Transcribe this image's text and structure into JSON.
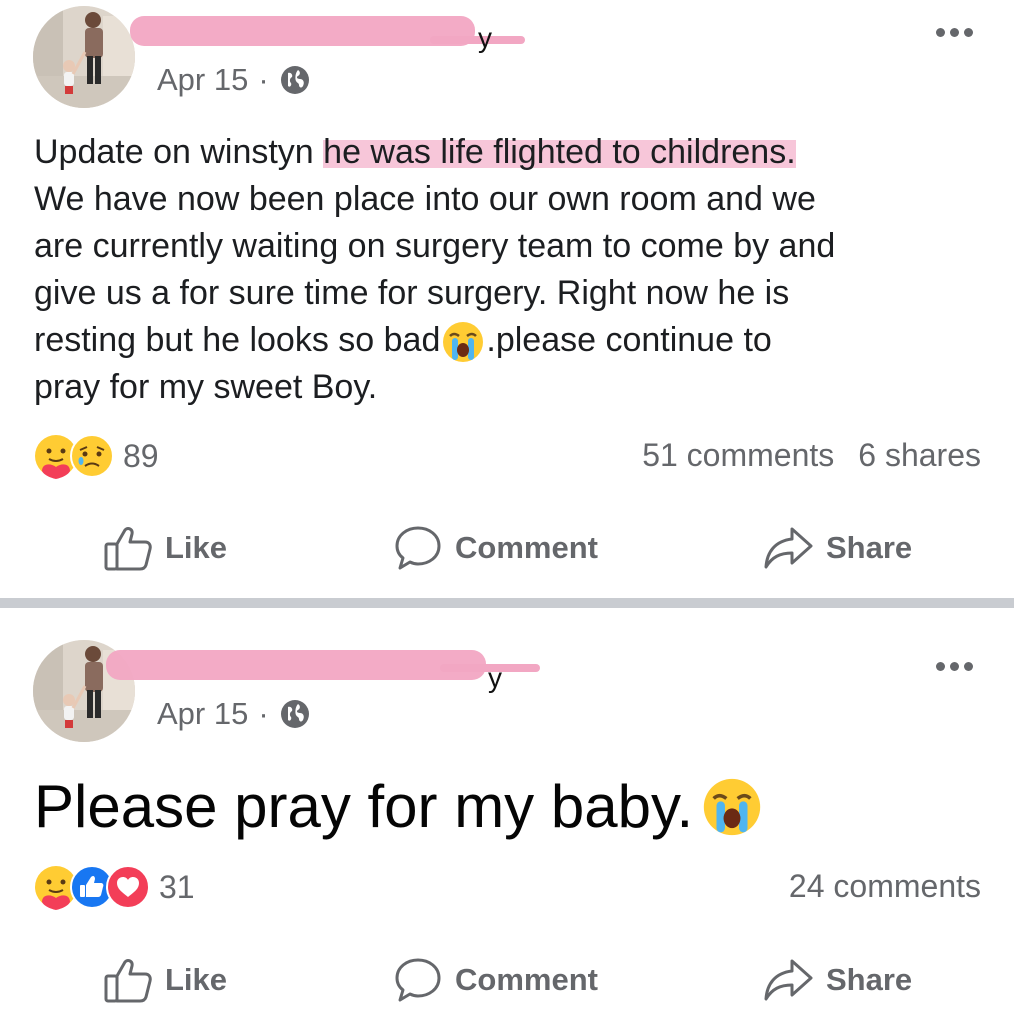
{
  "posts": [
    {
      "date": "Apr 15",
      "separator": "·",
      "text_before": "Update on winstyn ",
      "text_highlight": "he was life flighted to childrens.",
      "text_line2": "We have now been place into our own room and we",
      "text_line3": "are currently waiting on surgery team to come by and",
      "text_line4": "give us a for sure time for surgery.  Right now he is",
      "text_line5a": "resting but he looks so bad",
      "text_line5b": ".please continue to",
      "text_line6": "pray for my sweet Boy.",
      "reaction_count": "89",
      "comments": "51 comments",
      "shares": "6 shares",
      "reaction_icons": [
        "care-reaction-icon",
        "sad-reaction-icon"
      ]
    },
    {
      "date": "Apr 15",
      "separator": "·",
      "text": "Please pray for my baby.",
      "reaction_count": "31",
      "comments": "24 comments",
      "reaction_icons": [
        "care-reaction-icon",
        "like-reaction-icon",
        "love-reaction-icon"
      ]
    }
  ],
  "actions": {
    "like": "Like",
    "comment": "Comment",
    "share": "Share"
  },
  "colors": {
    "redaction": "#f2a7c3",
    "meta_text": "#65676b",
    "divider": "#c9ccd1",
    "like_blue": "#1877f2",
    "love_red": "#f33e58"
  }
}
